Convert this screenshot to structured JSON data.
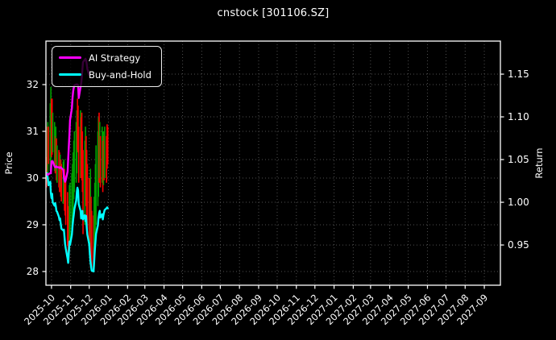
{
  "title": "cnstock [301106.SZ]",
  "legend": [
    {
      "label": "AI Strategy",
      "color": "#ff00ff"
    },
    {
      "label": "Buy-and-Hold",
      "color": "#00ffff"
    }
  ],
  "axes": {
    "left_label": "Price",
    "right_label": "Return",
    "price_ticks": [
      "28",
      "29",
      "30",
      "31",
      "32"
    ],
    "return_ticks": [
      "0.95",
      "1.00",
      "1.05",
      "1.10",
      "1.15"
    ],
    "x_ticks": [
      "2025-10",
      "2025-11",
      "2025-12",
      "2026-01",
      "2026-02",
      "2026-03",
      "2026-04",
      "2026-05",
      "2026-06",
      "2026-07",
      "2026-08",
      "2026-09",
      "2026-10",
      "2026-11",
      "2026-12",
      "2027-01",
      "2027-02",
      "2027-03",
      "2027-04",
      "2027-05",
      "2027-06",
      "2027-07",
      "2027-08",
      "2027-09"
    ]
  },
  "colors": {
    "background": "#000000",
    "foreground": "#ffffff",
    "grid": "#909090",
    "bar_up": "#00a000",
    "bar_down": "#ff0000",
    "ai_strategy": "#ff00ff",
    "buy_hold": "#00ffff"
  },
  "chart_data": {
    "type": "line",
    "title": "cnstock [301106.SZ]",
    "xlabel": "",
    "ylabel_left": "Price",
    "ylabel_right": "Return",
    "x_range": [
      "2025-09-22",
      "2027-09-27"
    ],
    "price_ylim": [
      27.707,
      32.931
    ],
    "return_ylim": [
      0.9029,
      1.1887
    ],
    "grid": true,
    "legend_position": "upper-left",
    "dates": [
      "2025-09-23",
      "2025-09-24",
      "2025-09-25",
      "2025-09-26",
      "2025-09-29",
      "2025-09-30",
      "2025-10-01",
      "2025-10-02",
      "2025-10-03",
      "2025-10-06",
      "2025-10-07",
      "2025-10-08",
      "2025-10-09",
      "2025-10-10",
      "2025-10-13",
      "2025-10-14",
      "2025-10-15",
      "2025-10-16",
      "2025-10-17",
      "2025-10-20",
      "2025-10-21",
      "2025-10-22",
      "2025-10-23",
      "2025-10-24",
      "2025-10-27",
      "2025-10-28",
      "2025-10-29",
      "2025-10-30",
      "2025-10-31",
      "2025-11-03",
      "2025-11-04",
      "2025-11-05",
      "2025-11-06",
      "2025-11-07",
      "2025-11-10",
      "2025-11-11",
      "2025-11-12",
      "2025-11-13",
      "2025-11-14",
      "2025-11-17",
      "2025-11-18",
      "2025-11-19",
      "2025-11-20",
      "2025-11-21",
      "2025-11-24",
      "2025-11-25",
      "2025-11-26",
      "2025-11-27",
      "2025-11-28",
      "2025-12-01",
      "2025-12-02",
      "2025-12-03",
      "2025-12-04",
      "2025-12-05",
      "2025-12-08",
      "2025-12-09",
      "2025-12-10",
      "2025-12-11",
      "2025-12-12",
      "2025-12-15",
      "2025-12-16",
      "2025-12-17",
      "2025-12-18",
      "2025-12-19",
      "2025-12-22",
      "2025-12-23",
      "2025-12-24",
      "2025-12-25",
      "2025-12-26",
      "2025-12-29",
      "2025-12-30",
      "2025-12-31"
    ],
    "price_bars": [
      [
        29.8,
        30.45,
        "d"
      ],
      [
        30.3,
        31.1,
        "d"
      ],
      [
        30.1,
        31.2,
        "u"
      ],
      [
        30.3,
        31.1,
        "d"
      ],
      [
        30.15,
        31.6,
        "u"
      ],
      [
        30.2,
        31.95,
        "u"
      ],
      [
        30.45,
        31.7,
        "d"
      ],
      [
        30.5,
        31.7,
        "d"
      ],
      [
        30.55,
        31.4,
        "u"
      ],
      [
        30.15,
        31.2,
        "u"
      ],
      [
        30.1,
        30.9,
        "d"
      ],
      [
        30.15,
        31.1,
        "u"
      ],
      [
        29.95,
        30.85,
        "d"
      ],
      [
        29.9,
        30.7,
        "u"
      ],
      [
        29.8,
        30.6,
        "d"
      ],
      [
        29.7,
        30.55,
        "d"
      ],
      [
        29.8,
        30.5,
        "u"
      ],
      [
        29.6,
        30.4,
        "d"
      ],
      [
        29.5,
        30.3,
        "d"
      ],
      [
        29.45,
        30.35,
        "u"
      ],
      [
        29.5,
        30.4,
        "u"
      ],
      [
        29.3,
        30.2,
        "d"
      ],
      [
        29.2,
        30.05,
        "d"
      ],
      [
        29.0,
        29.95,
        "d"
      ],
      [
        28.55,
        29.7,
        "d"
      ],
      [
        28.3,
        29.4,
        "d"
      ],
      [
        28.2,
        29.3,
        "d"
      ],
      [
        28.45,
        29.85,
        "u"
      ],
      [
        28.7,
        29.9,
        "u"
      ],
      [
        28.9,
        30.1,
        "u"
      ],
      [
        29.1,
        30.3,
        "u"
      ],
      [
        29.3,
        30.55,
        "u"
      ],
      [
        29.55,
        30.8,
        "u"
      ],
      [
        29.7,
        31.0,
        "u"
      ],
      [
        29.9,
        31.2,
        "u"
      ],
      [
        30.1,
        31.45,
        "u"
      ],
      [
        30.6,
        31.7,
        "d"
      ],
      [
        30.55,
        31.55,
        "d"
      ],
      [
        29.9,
        31.1,
        "d"
      ],
      [
        30.0,
        31.45,
        "u"
      ],
      [
        30.0,
        31.3,
        "d"
      ],
      [
        29.95,
        31.4,
        "d"
      ],
      [
        29.7,
        31.0,
        "d"
      ],
      [
        28.8,
        30.6,
        "d"
      ],
      [
        29.0,
        30.8,
        "u"
      ],
      [
        29.5,
        31.1,
        "u"
      ],
      [
        29.4,
        30.9,
        "d"
      ],
      [
        29.2,
        30.6,
        "d"
      ],
      [
        28.9,
        30.3,
        "d"
      ],
      [
        28.6,
        30.0,
        "d"
      ],
      [
        28.4,
        29.8,
        "d"
      ],
      [
        28.3,
        30.2,
        "u"
      ],
      [
        28.15,
        29.6,
        "d"
      ],
      [
        28.05,
        29.3,
        "d"
      ],
      [
        28.0,
        29.2,
        "d"
      ],
      [
        28.1,
        29.6,
        "u"
      ],
      [
        28.4,
        29.9,
        "u"
      ],
      [
        28.7,
        30.3,
        "u"
      ],
      [
        29.0,
        30.7,
        "u"
      ],
      [
        29.4,
        31.0,
        "u"
      ],
      [
        29.6,
        31.3,
        "u"
      ],
      [
        29.9,
        31.4,
        "d"
      ],
      [
        30.0,
        31.2,
        "u"
      ],
      [
        29.8,
        30.9,
        "d"
      ],
      [
        29.9,
        31.1,
        "u"
      ],
      [
        29.7,
        30.8,
        "d"
      ],
      [
        29.85,
        31.0,
        "u"
      ],
      [
        29.95,
        30.9,
        "d"
      ],
      [
        30.0,
        31.1,
        "u"
      ],
      [
        29.9,
        30.9,
        "d"
      ],
      [
        30.2,
        31.15,
        "d"
      ],
      [
        30.3,
        31.1,
        "d"
      ]
    ],
    "series": [
      {
        "name": "AI Strategy",
        "axis": "return",
        "values": [
          1.033,
          1.033,
          1.032,
          1.033,
          1.034,
          1.034,
          1.048,
          1.047,
          1.048,
          1.042,
          1.041,
          1.041,
          1.042,
          1.041,
          1.041,
          1.04,
          1.041,
          1.041,
          1.04,
          1.038,
          1.03,
          1.026,
          1.024,
          1.026,
          1.036,
          1.05,
          1.065,
          1.08,
          1.096,
          1.11,
          1.122,
          1.13,
          1.134,
          1.137,
          1.138,
          1.138,
          1.138,
          1.137,
          1.122,
          1.135,
          1.139,
          1.146,
          1.156,
          1.164,
          1.167,
          1.168,
          1.166,
          1.162,
          1.156,
          1.149,
          null,
          null,
          null,
          null,
          null,
          null,
          null,
          null,
          null,
          null,
          null,
          null,
          null,
          null,
          null,
          null,
          null,
          null,
          null,
          null,
          null,
          null
        ]
      },
      {
        "name": "Buy-and-Hold",
        "axis": "return",
        "values": [
          1.031,
          1.034,
          1.028,
          1.02,
          1.024,
          1.011,
          1.005,
          1.01,
          1.0,
          0.996,
          0.999,
          0.995,
          0.99,
          0.989,
          0.983,
          0.979,
          0.981,
          0.975,
          0.969,
          0.967,
          0.968,
          0.96,
          0.951,
          0.946,
          0.934,
          0.929,
          0.941,
          0.954,
          0.95,
          0.962,
          0.972,
          0.98,
          0.985,
          0.992,
          1.002,
          1.012,
          1.017,
          1.014,
          0.998,
          0.99,
          0.981,
          0.986,
          0.99,
          0.98,
          0.985,
          0.978,
          0.984,
          0.971,
          0.962,
          0.951,
          0.94,
          0.931,
          0.925,
          0.92,
          0.919,
          0.931,
          0.943,
          0.953,
          0.963,
          0.973,
          0.981,
          0.987,
          0.99,
          0.982,
          0.986,
          0.98,
          0.985,
          0.988,
          0.991,
          0.993,
          0.994,
          0.993
        ]
      }
    ]
  }
}
